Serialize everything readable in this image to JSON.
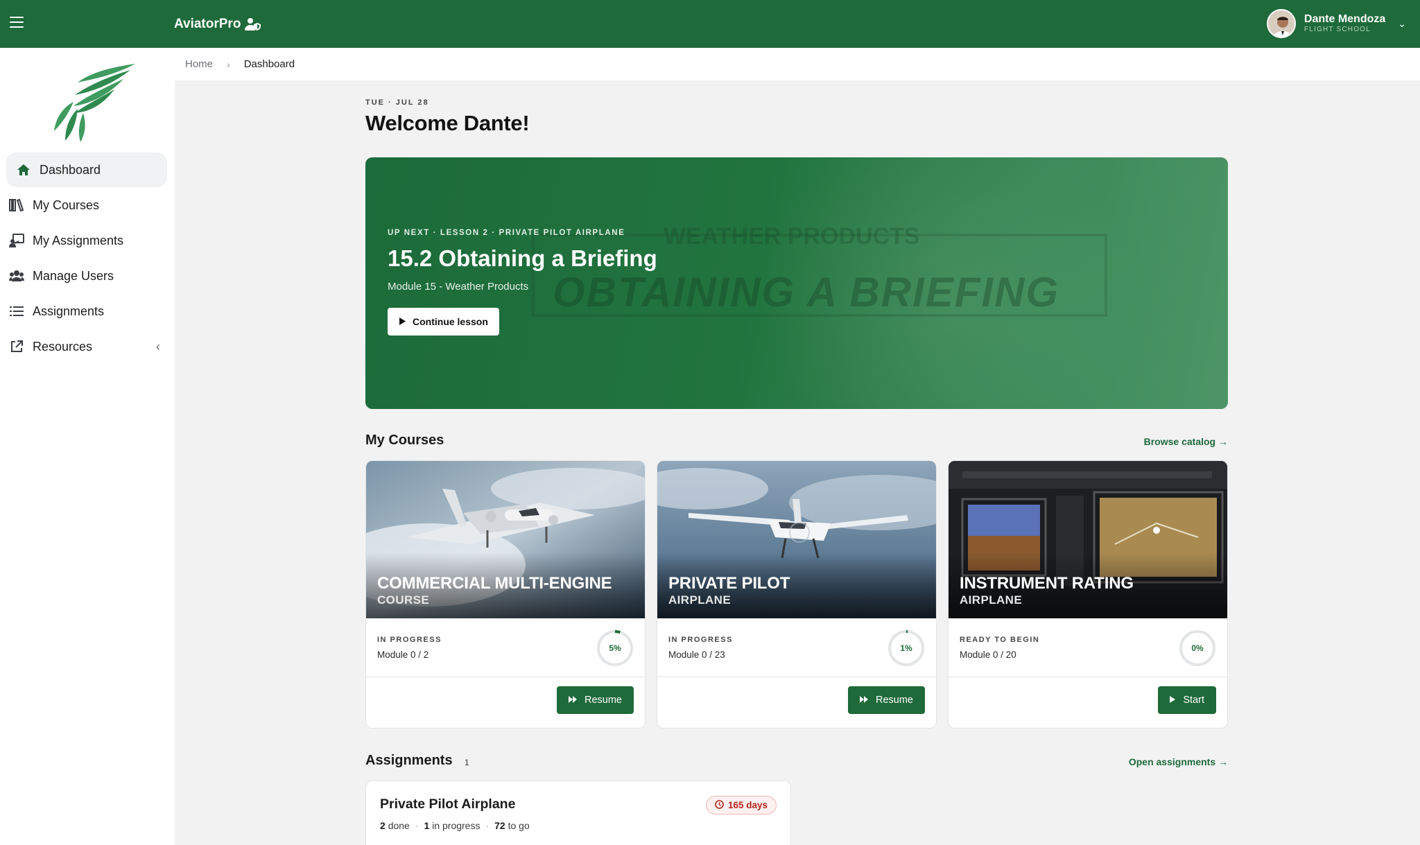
{
  "app": {
    "brand": "AviatorPro"
  },
  "user": {
    "name": "Dante Mendoza",
    "role": "FLIGHT SCHOOL"
  },
  "sidebar": {
    "items": [
      {
        "label": "Dashboard",
        "icon": "home-icon",
        "active": true
      },
      {
        "label": "My Courses",
        "icon": "books-icon"
      },
      {
        "label": "My Assignments",
        "icon": "chalkboard-icon"
      },
      {
        "label": "Manage Users",
        "icon": "users-icon"
      },
      {
        "label": "Assignments",
        "icon": "list-icon"
      },
      {
        "label": "Resources",
        "icon": "external-link-icon"
      }
    ]
  },
  "breadcrumb": {
    "home": "Home",
    "current": "Dashboard"
  },
  "header": {
    "date": "TUE · JUL 28",
    "welcome": "Welcome Dante!"
  },
  "hero": {
    "eyebrow": "UP NEXT · LESSON 2 · PRIVATE PILOT AIRPLANE",
    "title": "15.2 Obtaining a Briefing",
    "subtitle": "Module 15 - Weather Products",
    "button": "Continue lesson",
    "bg_text_main": "OBTAINING A BRIEFING",
    "bg_text_top": "WEATHER PRODUCTS"
  },
  "courses": {
    "title": "My Courses",
    "link": "Browse catalog →",
    "items": [
      {
        "name": "COMMERCIAL MULTI-ENGINE",
        "sub": "COURSE",
        "status": "IN PROGRESS",
        "module": "Module 0 / 2",
        "progress_label": "5%",
        "progress": 0.05,
        "button": "Resume",
        "button_icon": "fast-forward-icon"
      },
      {
        "name": "PRIVATE PILOT",
        "sub": "AIRPLANE",
        "status": "IN PROGRESS",
        "module": "Module 0 / 23",
        "progress_label": "1%",
        "progress": 0.01,
        "button": "Resume",
        "button_icon": "fast-forward-icon"
      },
      {
        "name": "INSTRUMENT RATING",
        "sub": "AIRPLANE",
        "status": "READY TO BEGIN",
        "module": "Module 0 / 20",
        "progress_label": "0%",
        "progress": 0,
        "button": "Start",
        "button_icon": "play-icon"
      }
    ]
  },
  "assignments": {
    "title": "Assignments",
    "count": "1",
    "link": "Open assignments →",
    "items": [
      {
        "name": "Private Pilot Airplane",
        "badge": "165 days",
        "done": "2",
        "done_label": "done",
        "in_progress": "1",
        "in_progress_label": "in progress",
        "to_go": "72",
        "to_go_label": "to go"
      }
    ]
  },
  "colors": {
    "brand_green": "#1e6a3a",
    "badge_red": "#b3261e"
  }
}
